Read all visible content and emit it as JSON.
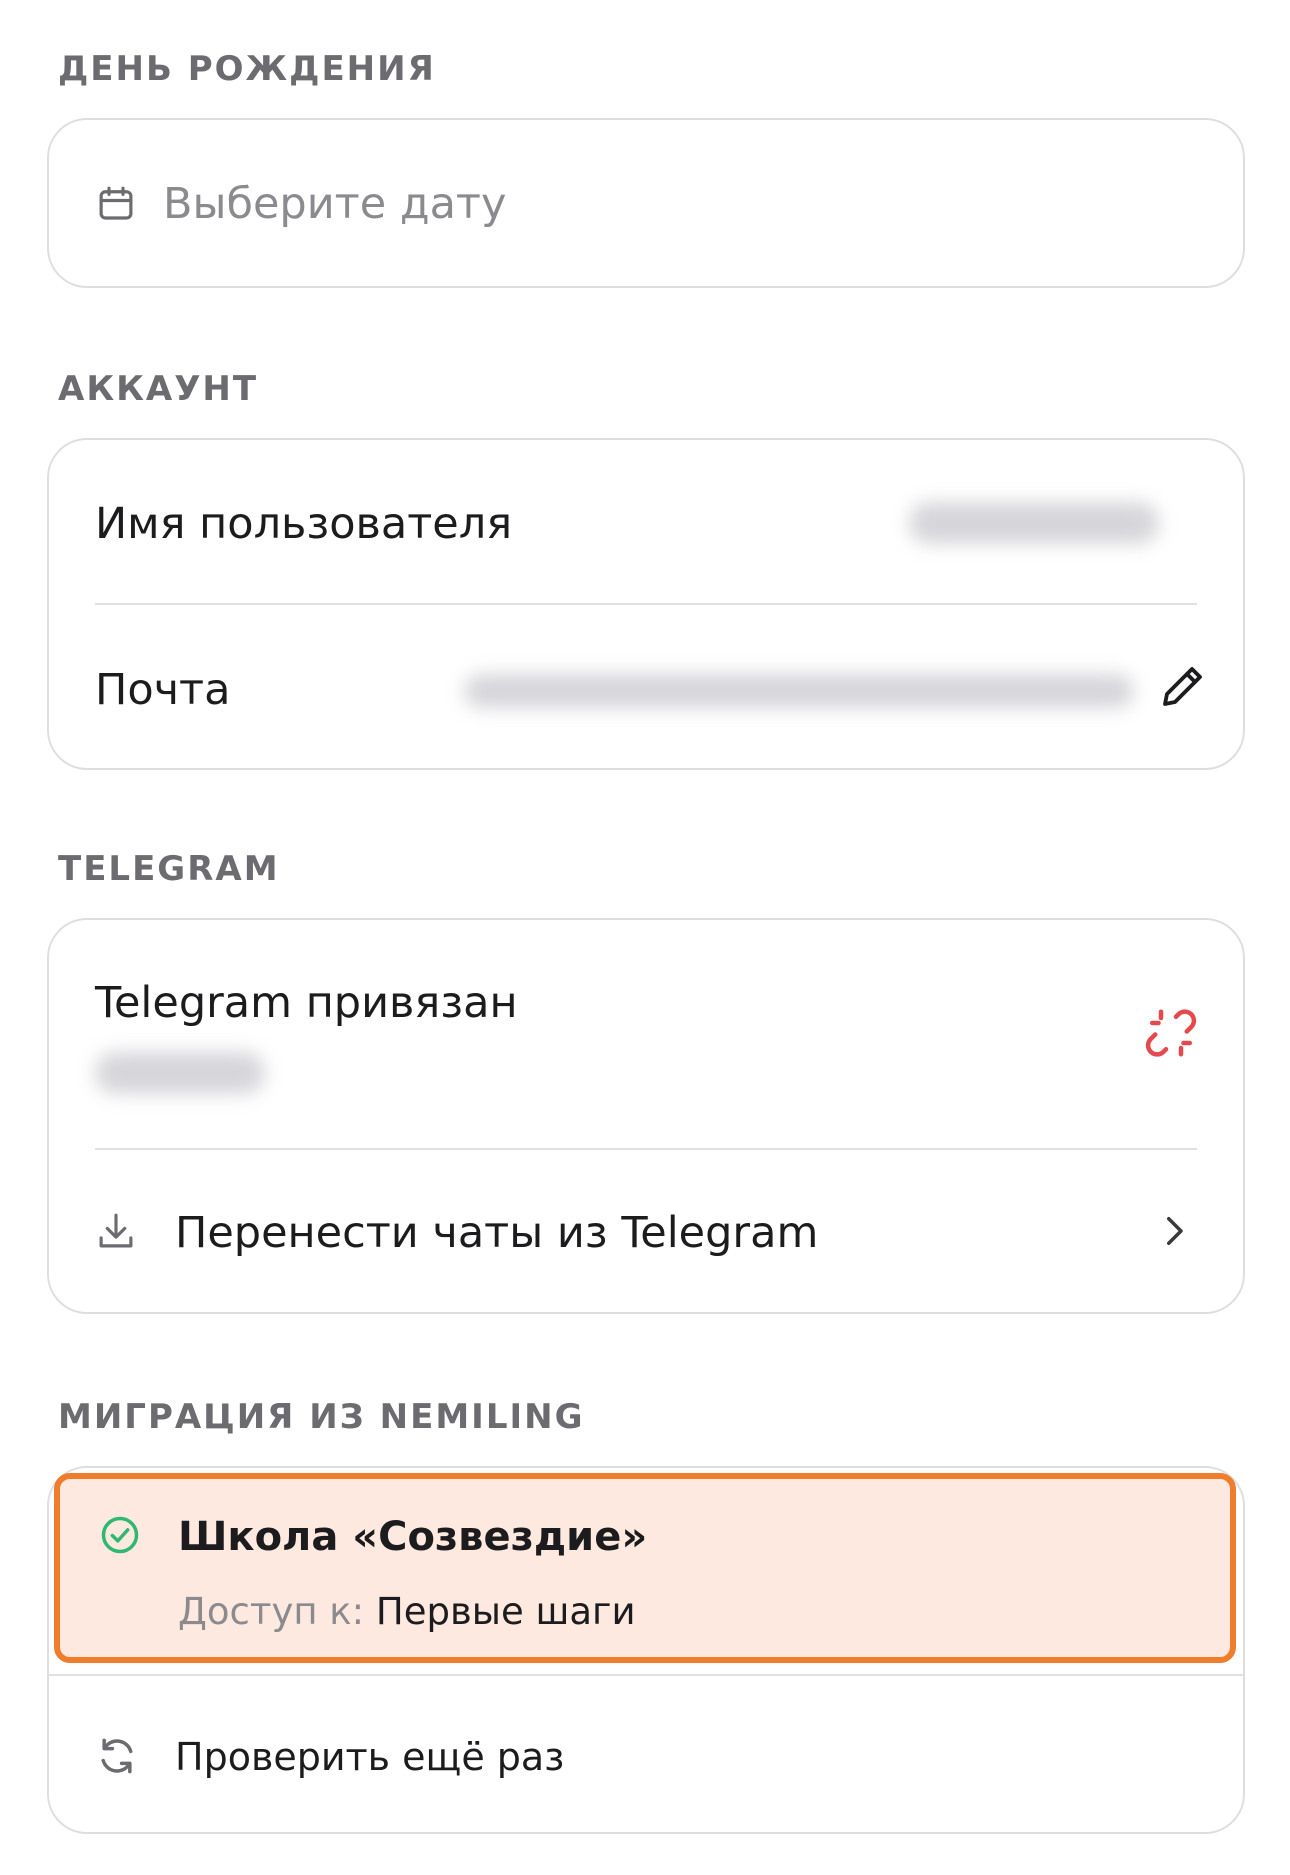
{
  "birthday": {
    "section_title": "ДЕНЬ РОЖДЕНИЯ",
    "date_placeholder": "Выберите дату",
    "calendar_icon": "calendar-icon"
  },
  "account": {
    "section_title": "АККАУНТ",
    "username_label": "Имя пользователя",
    "email_label": "Почта",
    "edit_icon": "pencil-icon"
  },
  "telegram": {
    "section_title": "TELEGRAM",
    "status_label": "Telegram привязан",
    "unlink_icon": "broken-link-icon",
    "unlink_color": "#e5484d",
    "transfer_label": "Перенести чаты из Telegram",
    "transfer_icon": "download-icon",
    "chevron_icon": "chevron-right-icon"
  },
  "migration": {
    "section_title": "МИГРАЦИЯ ИЗ NEMILING",
    "school_name": "Школа «Созвездие»",
    "access_prefix": "Доступ к:",
    "access_value": "Первые шаги",
    "status_icon": "check-circle-icon",
    "status_color": "#2eb872",
    "highlight_color": "#ef7d2b",
    "retry_label": "Проверить ещё раз",
    "retry_icon": "refresh-icon"
  }
}
